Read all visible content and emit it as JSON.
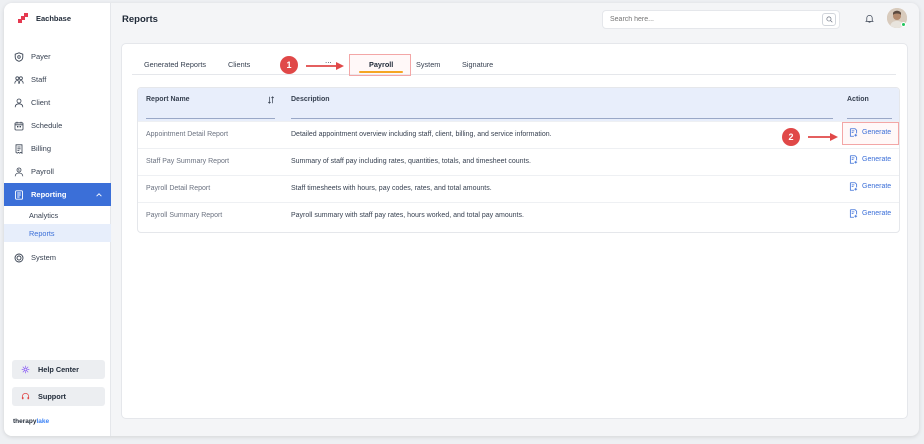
{
  "app": {
    "brand": "Eachbase",
    "footer_brand_a": "therapy",
    "footer_brand_b": "lake"
  },
  "header": {
    "title": "Reports",
    "search_placeholder": "Search here..."
  },
  "sidebar": {
    "items": [
      {
        "label": "Payer",
        "icon": "shield-icon"
      },
      {
        "label": "Staff",
        "icon": "staff-icon"
      },
      {
        "label": "Client",
        "icon": "user-icon"
      },
      {
        "label": "Schedule",
        "icon": "calendar-icon"
      },
      {
        "label": "Billing",
        "icon": "receipt-icon"
      },
      {
        "label": "Payroll",
        "icon": "payroll-icon"
      },
      {
        "label": "Reporting",
        "icon": "report-icon"
      },
      {
        "label": "System",
        "icon": "target-icon"
      }
    ],
    "sub_items": [
      {
        "label": "Analytics"
      },
      {
        "label": "Reports"
      }
    ],
    "help_label": "Help Center",
    "support_label": "Support"
  },
  "tabs": [
    {
      "label": "Generated Reports"
    },
    {
      "label": "Clients"
    },
    {
      "label": "..."
    },
    {
      "label": "Payroll"
    },
    {
      "label": "System"
    },
    {
      "label": "Signature"
    }
  ],
  "annotations": {
    "step1": "1",
    "step2": "2"
  },
  "table": {
    "headers": {
      "name": "Report Name",
      "description": "Description",
      "action": "Action"
    },
    "rows": [
      {
        "name": "Appointment Detail Report",
        "description": "Detailed appointment overview including staff, client, billing, and service information.",
        "action": "Generate"
      },
      {
        "name": "Staff Pay Summary Report",
        "description": "Summary of staff pay including rates, quantities, totals, and timesheet counts.",
        "action": "Generate"
      },
      {
        "name": "Payroll Detail Report",
        "description": "Staff timesheets with hours, pay codes, rates, and total amounts.",
        "action": "Generate"
      },
      {
        "name": "Payroll Summary Report",
        "description": "Payroll summary with staff pay rates, hours worked, and total pay amounts.",
        "action": "Generate"
      }
    ]
  },
  "colors": {
    "accent": "#3b6fd8",
    "tab_indicator": "#f5a623",
    "annotation": "#e04848",
    "brand": "#e53950"
  }
}
